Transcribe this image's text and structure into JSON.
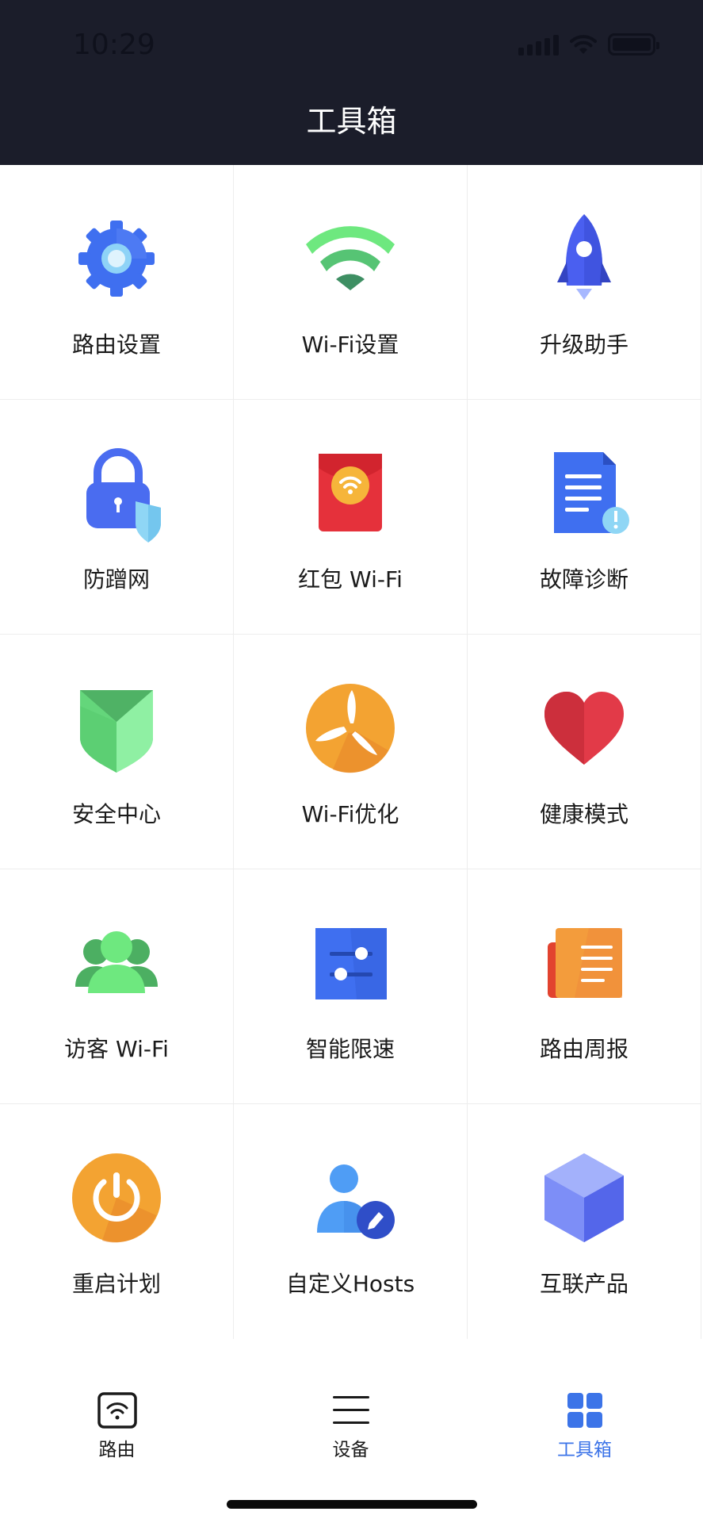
{
  "status_bar": {
    "time": "10:29"
  },
  "header": {
    "title": "工具箱"
  },
  "tools": [
    {
      "label": "路由设置",
      "icon": "gear-icon"
    },
    {
      "label": "Wi-Fi设置",
      "icon": "wifi-icon"
    },
    {
      "label": "升级助手",
      "icon": "rocket-icon"
    },
    {
      "label": "防蹭网",
      "icon": "lock-shield-icon"
    },
    {
      "label": "红包 Wi-Fi",
      "icon": "red-envelope-wifi-icon"
    },
    {
      "label": "故障诊断",
      "icon": "document-alert-icon"
    },
    {
      "label": "安全中心",
      "icon": "shield-icon"
    },
    {
      "label": "Wi-Fi优化",
      "icon": "fan-icon"
    },
    {
      "label": "健康模式",
      "icon": "heart-icon"
    },
    {
      "label": "访客 Wi-Fi",
      "icon": "guests-icon"
    },
    {
      "label": "智能限速",
      "icon": "sliders-icon"
    },
    {
      "label": "路由周报",
      "icon": "report-icon"
    },
    {
      "label": "重启计划",
      "icon": "power-icon"
    },
    {
      "label": "自定义Hosts",
      "icon": "user-edit-icon"
    },
    {
      "label": "互联产品",
      "icon": "cube-icon"
    }
  ],
  "tabbar": {
    "tabs": [
      {
        "label": "路由",
        "icon": "router-wifi-icon",
        "active": false
      },
      {
        "label": "设备",
        "icon": "menu-icon",
        "active": false
      },
      {
        "label": "工具箱",
        "icon": "grid-icon",
        "active": true
      }
    ],
    "active_color": "#3c74e8"
  },
  "colors": {
    "header_bg": "#1b1d2a",
    "accent": "#3c74e8"
  }
}
